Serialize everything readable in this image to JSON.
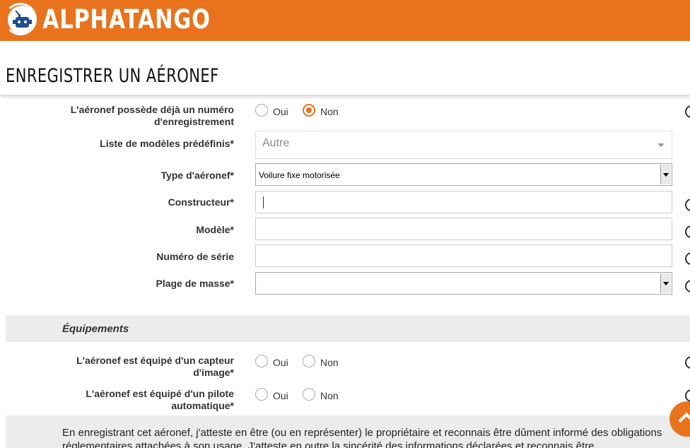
{
  "header": {
    "logo_text": "ALPHATANGO",
    "brand_color": "#e8731c"
  },
  "page": {
    "title": "ENREGISTRER UN AÉRONEF"
  },
  "form": {
    "registration_question": "L'aéronef possède déjà un numéro d'enregistrement",
    "registration_options": {
      "yes": "Oui",
      "no": "Non",
      "selected": "Non"
    },
    "predefined_models_label": "Liste de modèles prédéfinis*",
    "predefined_models_value": "Autre",
    "aircraft_type_label": "Type d'aéronef*",
    "aircraft_type_value": "Voilure fixe motorisée",
    "manufacturer_label": "Constructeur*",
    "manufacturer_value": "",
    "model_label": "Modèle*",
    "model_value": "",
    "serial_label": "Numéro de série",
    "serial_value": "",
    "mass_label": "Plage de masse*",
    "mass_value": ""
  },
  "equipment": {
    "section_title": "Équipements",
    "camera_question": "L'aéronef est équipé d'un capteur d'image*",
    "camera_options": {
      "yes": "Oui",
      "no": "Non",
      "selected": ""
    },
    "autopilot_question": "L'aéronef est équipé d'un pilote automatique*",
    "autopilot_options": {
      "yes": "Oui",
      "no": "Non",
      "selected": ""
    }
  },
  "notice": {
    "text": "En enregistrant cet aéronef, j'atteste en être (ou en représenter) le propriétaire et reconnais être dûment informé des obligations réglementaires attachées à son usage. J'atteste en outre la sincérité des informations déclarées et reconnais être"
  }
}
